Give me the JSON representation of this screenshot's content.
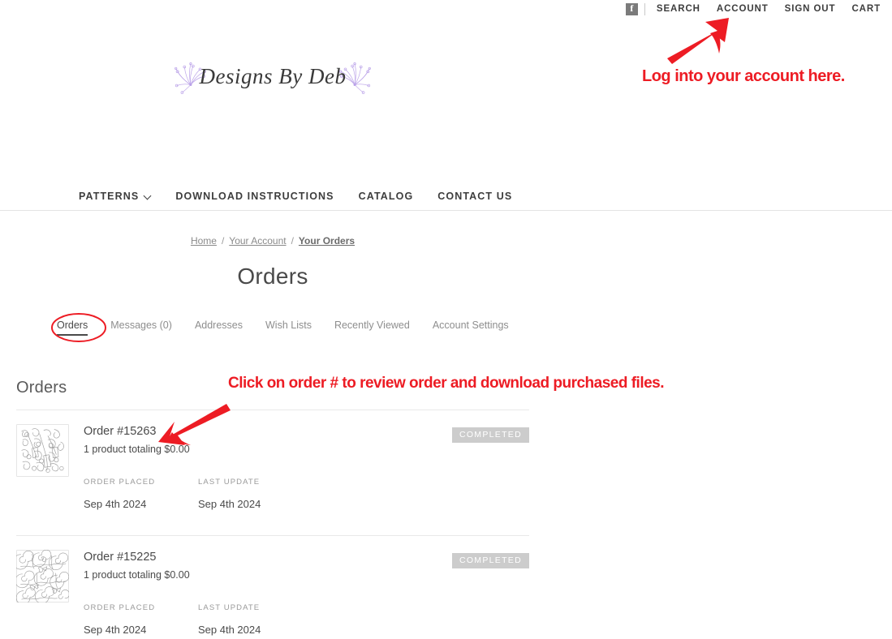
{
  "topbar": {
    "facebook_label": "f",
    "links": [
      {
        "label": "SEARCH",
        "name": "search"
      },
      {
        "label": "ACCOUNT",
        "name": "account"
      },
      {
        "label": "SIGN OUT",
        "name": "sign-out"
      },
      {
        "label": "CART",
        "name": "cart"
      }
    ]
  },
  "logo": {
    "text": "Designs By Deb",
    "ornament_color": "#b9a0e8"
  },
  "mainnav": {
    "items": [
      {
        "label": "PATTERNS",
        "has_dropdown": true
      },
      {
        "label": "DOWNLOAD INSTRUCTIONS",
        "has_dropdown": false
      },
      {
        "label": "CATALOG",
        "has_dropdown": false
      },
      {
        "label": "CONTACT US",
        "has_dropdown": false
      }
    ]
  },
  "breadcrumb": {
    "items": [
      {
        "label": "Home",
        "current": false
      },
      {
        "label": "Your Account",
        "current": false
      },
      {
        "label": "Your Orders",
        "current": true
      }
    ],
    "separator": "/"
  },
  "page": {
    "title": "Orders"
  },
  "account_tabs": [
    {
      "label": "Orders",
      "active": true
    },
    {
      "label": "Messages (0)",
      "active": false
    },
    {
      "label": "Addresses",
      "active": false
    },
    {
      "label": "Wish Lists",
      "active": false
    },
    {
      "label": "Recently Viewed",
      "active": false
    },
    {
      "label": "Account Settings",
      "active": false
    }
  ],
  "orders_section": {
    "heading": "Orders",
    "meta_labels": {
      "order_placed": "ORDER PLACED",
      "last_update": "LAST UPDATE"
    },
    "orders": [
      {
        "number": "Order #15263",
        "summary": "1 product totaling $0.00",
        "status": "COMPLETED",
        "order_placed": "Sep 4th 2024",
        "last_update": "Sep 4th 2024",
        "thumbnail": "wine-grapes-quilting-pattern"
      },
      {
        "number": "Order #15225",
        "summary": "1 product totaling $0.00",
        "status": "COMPLETED",
        "order_placed": "Sep 4th 2024",
        "last_update": "Sep 4th 2024",
        "thumbnail": "swirls-birds-quilting-pattern"
      }
    ]
  },
  "annotations": {
    "color": "#ed1c24",
    "login_text": "Log into your account here.",
    "click_text": "Click on order # to review order and download purchased files."
  }
}
